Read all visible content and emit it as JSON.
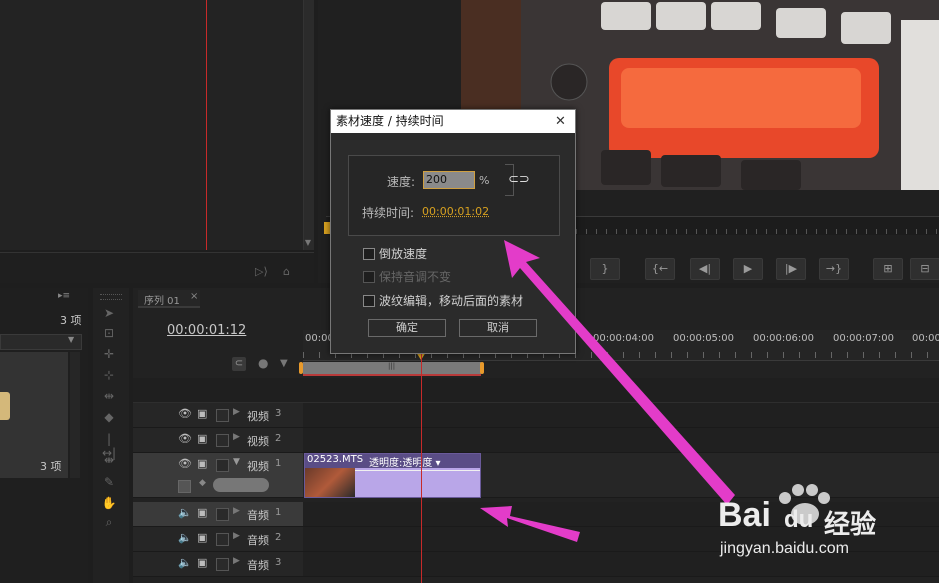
{
  "program_panel": {
    "timecode_ruler": ""
  },
  "project_panel": {
    "item_count_top": "3 项",
    "item_count_bottom": "3 项"
  },
  "sequence": {
    "tab_label": "序列 01",
    "timecode": "00:00:01:12",
    "ruler": [
      "00:00",
      "00:00:04:00",
      "00:00:05:00",
      "00:00:06:00",
      "00:00:07:00",
      "00:00"
    ],
    "tracks": [
      {
        "label": "视频",
        "num": "3",
        "kind": "video"
      },
      {
        "label": "视频",
        "num": "2",
        "kind": "video"
      },
      {
        "label": "视频",
        "num": "1",
        "kind": "video"
      },
      {
        "label": "音频",
        "num": "1",
        "kind": "audio"
      },
      {
        "label": "音频",
        "num": "2",
        "kind": "audio"
      },
      {
        "label": "音频",
        "num": "3",
        "kind": "audio"
      }
    ],
    "clip": {
      "name": "02523.MTS",
      "effect": "透明度:透明度 ▾"
    }
  },
  "dialog": {
    "title": "素材速度 / 持续时间",
    "speed_label": "速度:",
    "speed_value": "200",
    "speed_unit": "%",
    "duration_label": "持续时间:",
    "duration_value": "00:00:01:02",
    "reverse_label": "倒放速度",
    "maintain_pitch_label": "保持音调不变",
    "ripple_label": "波纹编辑，移动后面的素材",
    "ok_label": "确定",
    "cancel_label": "取消",
    "close_glyph": "✕"
  },
  "watermark": {
    "brand_a": "Bai",
    "brand_b": "du",
    "brand_cn": "经验",
    "url": "jingyan.baidu.com"
  },
  "colors": {
    "accent_red": "#c72a2a",
    "clip_purple": "#b9a6e8",
    "arrow_magenta": "#e33cc9"
  }
}
